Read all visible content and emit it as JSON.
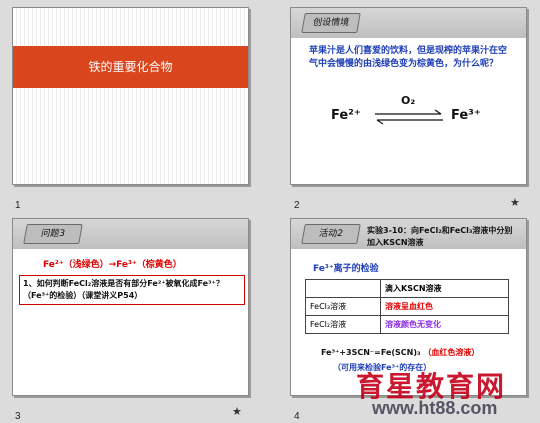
{
  "slides": [
    {
      "number": "1",
      "title": "铁的重要化合物"
    },
    {
      "number": "2",
      "tag": "创设情境",
      "text": "苹果汁是人们喜爱的饮料，但是现榨的苹果汁在空气中会慢慢的由浅绿色变为棕黄色，为什么呢？",
      "reaction": {
        "left": "Fe²⁺",
        "right": "Fe³⁺",
        "arrow_label": "O₂"
      }
    },
    {
      "number": "3",
      "tag": "问题3",
      "transform": "Fe²⁺（浅绿色）→Fe³⁺（棕黄色）",
      "question": "1、如何判断FeCl₂溶液是否有部分Fe²⁺被氧化成Fe³⁺？（Fe³⁺的检验）（课堂讲义P54）"
    },
    {
      "number": "4",
      "tag": "活动2",
      "experiment": "实验3-10：向FeCl₂和FeCl₃溶液中分别加入KSCN溶液",
      "subheading": "Fe³⁺离子的检验",
      "table": {
        "header": [
          "",
          "滴入KSCN溶液"
        ],
        "rows": [
          [
            "FeCl₃溶液",
            "溶液呈血红色"
          ],
          [
            "FeCl₂溶液",
            "溶液颜色无变化"
          ]
        ]
      },
      "equation": "Fe³⁺+3SCN⁻=Fe(SCN)₃",
      "equation_note": "（血红色溶液）",
      "usage_note": "（可用来检验Fe³⁺的存在）"
    }
  ],
  "star_glyph": "★",
  "watermark": {
    "brand": "育星教育网",
    "url": "www.ht88.com"
  }
}
